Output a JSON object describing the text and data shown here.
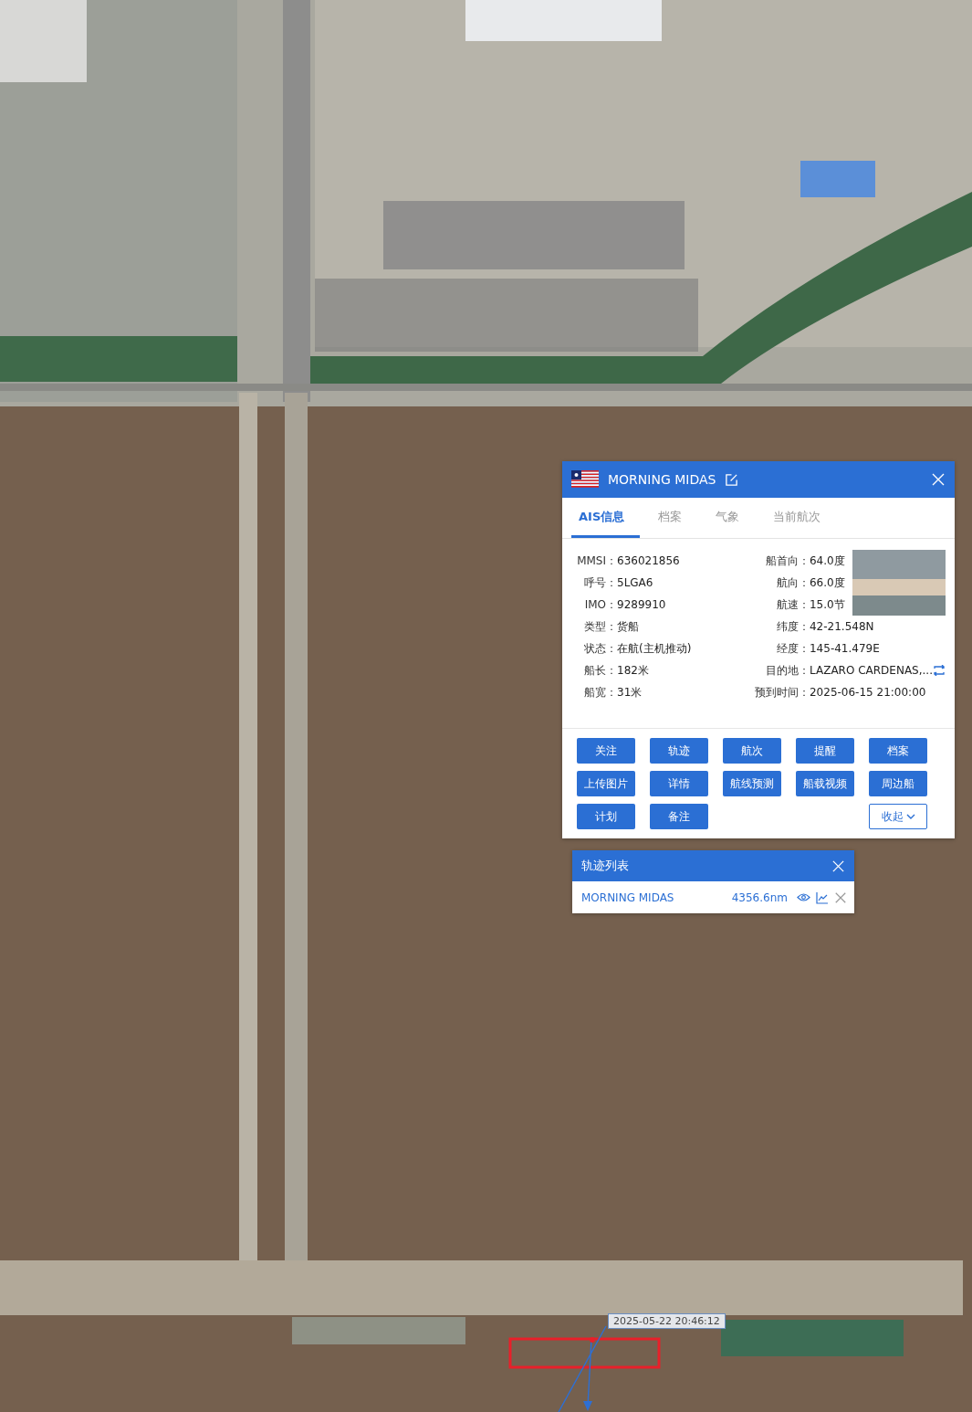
{
  "map": {
    "timestamp_label": "2025-05-22 20:46:12"
  },
  "ship_panel": {
    "title": "MORNING MIDAS",
    "tabs": [
      {
        "label": "AIS信息",
        "selected": true
      },
      {
        "label": "档案",
        "selected": false
      },
      {
        "label": "气象",
        "selected": false
      },
      {
        "label": "当前航次",
        "selected": false
      }
    ],
    "fields_left": [
      {
        "label": "MMSI：",
        "value": "636021856"
      },
      {
        "label": "呼号：",
        "value": "5LGA6"
      },
      {
        "label": "IMO：",
        "value": "9289910"
      },
      {
        "label": "类型：",
        "value": "货船"
      },
      {
        "label": "状态：",
        "value": "在航(主机推动)"
      },
      {
        "label": "船长：",
        "value": "182米"
      },
      {
        "label": "船宽：",
        "value": "31米"
      }
    ],
    "fields_right": [
      {
        "label": "船首向：",
        "value": "64.0度",
        "kind": "plain"
      },
      {
        "label": "航向：",
        "value": "66.0度",
        "kind": "plain"
      },
      {
        "label": "航速：",
        "value": "15.0节",
        "kind": "plain"
      },
      {
        "label": "纬度：",
        "value": "42-21.548N",
        "kind": "plain"
      },
      {
        "label": "经度：",
        "value": "145-41.479E",
        "kind": "plain"
      },
      {
        "label": "目的地：",
        "value": "LAZARO CARDENAS,...",
        "kind": "with_icon"
      },
      {
        "label": "预到时间：",
        "value": "2025-06-15 21:00:00",
        "kind": "plain"
      }
    ],
    "buttons": [
      {
        "label": "关注",
        "kind": "primary"
      },
      {
        "label": "轨迹",
        "kind": "primary"
      },
      {
        "label": "航次",
        "kind": "primary"
      },
      {
        "label": "提醒",
        "kind": "primary"
      },
      {
        "label": "档案",
        "kind": "primary"
      },
      {
        "label": "上传图片",
        "kind": "primary"
      },
      {
        "label": "详情",
        "kind": "primary"
      },
      {
        "label": "航线预测",
        "kind": "primary"
      },
      {
        "label": "船载视频",
        "kind": "primary"
      },
      {
        "label": "周边船",
        "kind": "primary"
      },
      {
        "label": "计划",
        "kind": "primary"
      },
      {
        "label": "备注",
        "kind": "primary"
      },
      {
        "label": "收起",
        "kind": "collapse"
      }
    ]
  },
  "track_list": {
    "title": "轨迹列表",
    "rows": [
      {
        "name": "MORNING MIDAS",
        "distance": "4356.6nm"
      }
    ]
  }
}
